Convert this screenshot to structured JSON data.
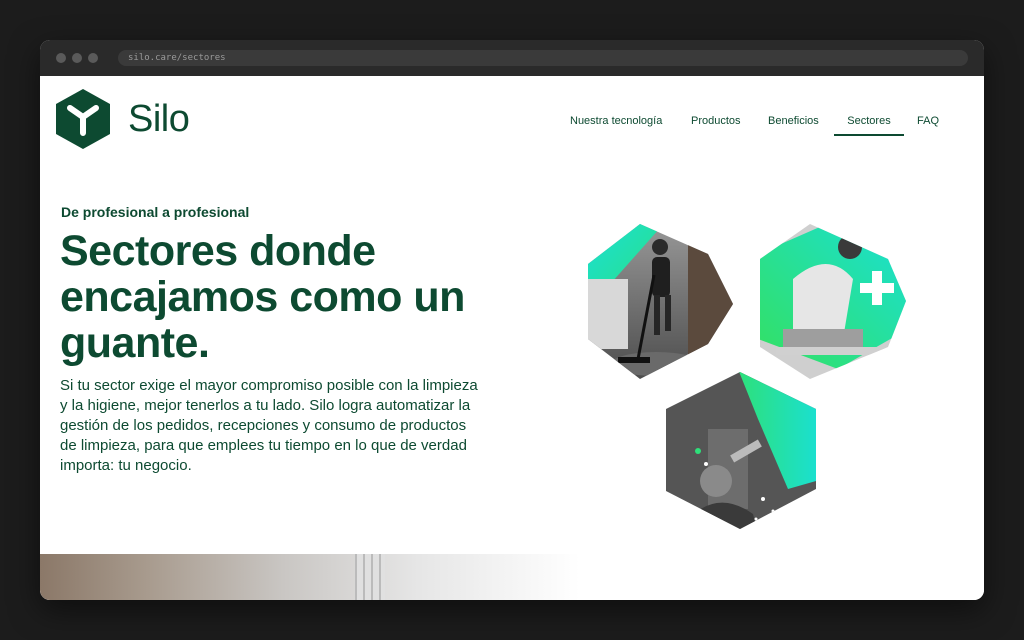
{
  "browser": {
    "url": "silo.care/sectores"
  },
  "header": {
    "logo_text": "Silo",
    "logo_icon": "silo-hexagon-logo",
    "nav": [
      {
        "label": "Nuestra tecnología"
      },
      {
        "label": "Productos"
      },
      {
        "label": "Beneficios"
      },
      {
        "label": "Sectores",
        "active": true
      },
      {
        "label": "FAQ"
      }
    ]
  },
  "hero": {
    "kicker": "De profesional a profesional",
    "title": "Sectores donde encajamos como un guante.",
    "description": "Si tu sector exige el mayor compromiso posible con la limpieza y la higiene, mejor tenerlos a tu lado. Silo logra automatizar la gestión de los pedidos, recepciones y consumo de productos de limpieza, para que emplees tu tiempo en lo que de verdad importa: tu negocio.",
    "images": [
      {
        "name": "cleaner-vacuum-image",
        "alt": "hotel-cleaning"
      },
      {
        "name": "nurse-hospital-image",
        "alt": "healthcare"
      },
      {
        "name": "window-cleaner-image",
        "alt": "window-cleaning"
      }
    ]
  },
  "colors": {
    "brand": "#0d4a31",
    "accent_green": "#2ee07a",
    "accent_cyan": "#19e0d6",
    "chrome": "#2a2a2a",
    "background": "#1c1c1c"
  }
}
